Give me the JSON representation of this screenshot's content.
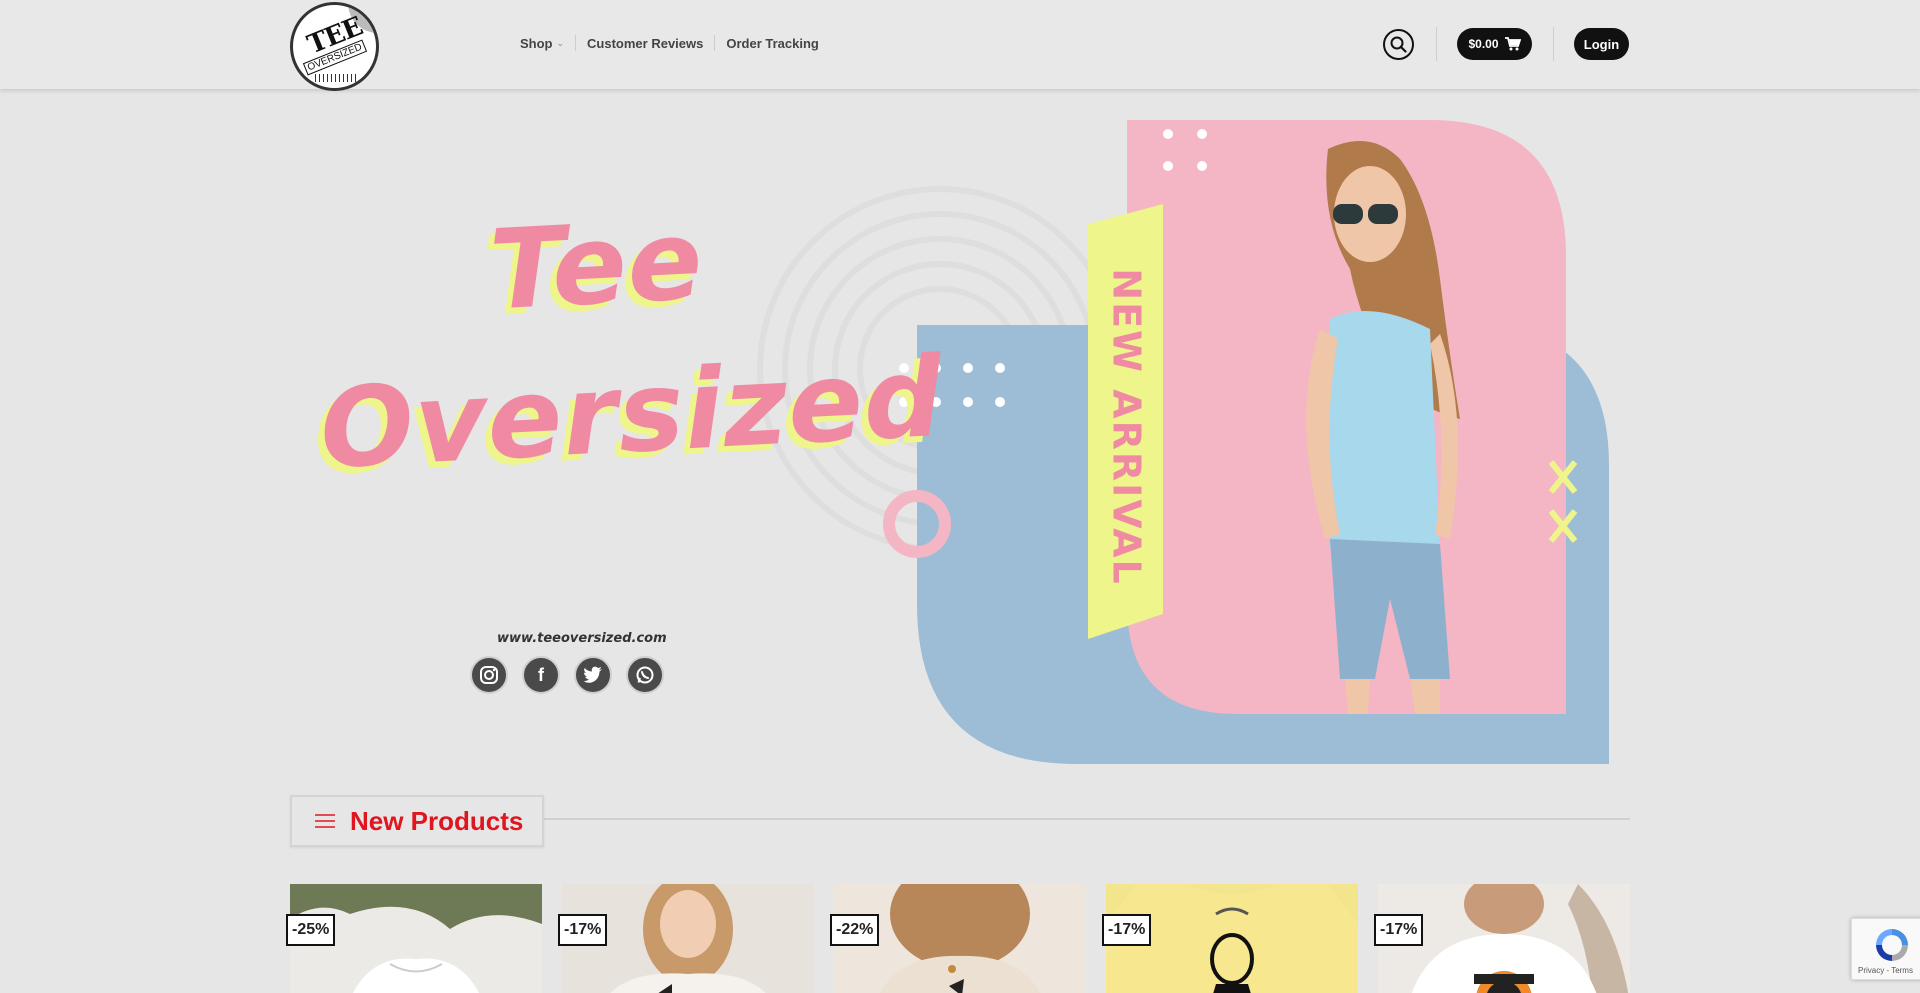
{
  "header": {
    "logo_text_top": "TEE",
    "logo_text_bottom": "OVERSIZED",
    "nav": [
      {
        "label": "Shop",
        "has_dropdown": true
      },
      {
        "label": "Customer Reviews"
      },
      {
        "label": "Order Tracking"
      }
    ],
    "cart_total": "$0.00",
    "login_label": "Login"
  },
  "hero": {
    "title_line1": "Tee",
    "title_line2": "Oversized",
    "badge_text": "NEW ARRIVAL",
    "url": "www.teeoversized.com",
    "socials": [
      "instagram-icon",
      "facebook-icon",
      "twitter-icon",
      "whatsapp-icon"
    ]
  },
  "section": {
    "title": "New Products"
  },
  "products": [
    {
      "discount": "-25%"
    },
    {
      "discount": "-17%"
    },
    {
      "discount": "-22%"
    },
    {
      "discount": "-17%"
    },
    {
      "discount": "-17%"
    }
  ],
  "recaptcha": {
    "links": "Privacy - Terms"
  },
  "colors": {
    "accent_red": "#e0151f",
    "pink": "#ef8aa2",
    "yellow": "#eef58a",
    "blue": "#9dbdd6"
  }
}
